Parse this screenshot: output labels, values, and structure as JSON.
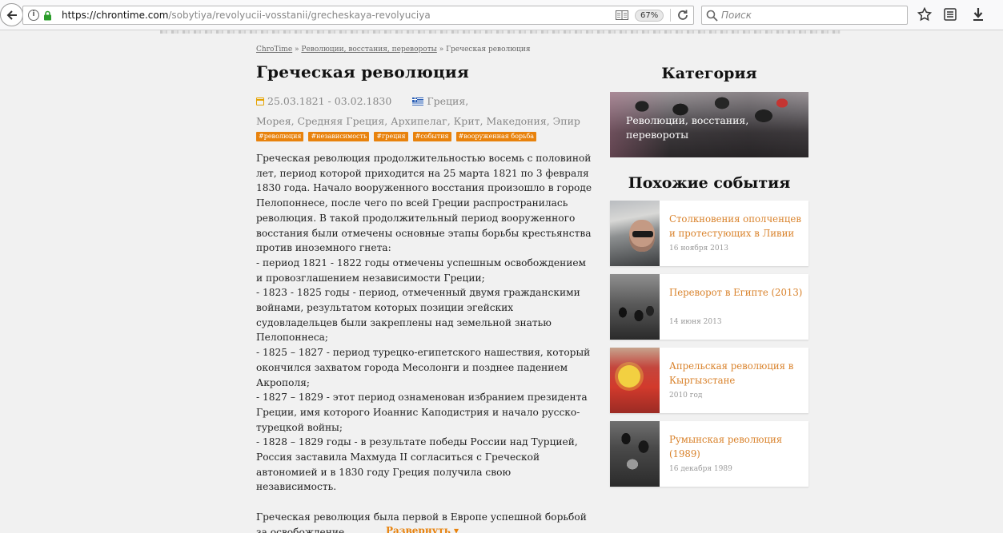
{
  "browser": {
    "url_host": "https://chrontime.com",
    "url_path": "/sobytiya/revolyucii-vosstanii/grecheskaya-revolyuciya",
    "zoom": "67%",
    "search_placeholder": "Поиск",
    "icons": [
      "back-arrow-icon",
      "info-icon",
      "lock-icon",
      "reader-view-icon",
      "reload-icon",
      "search-icon",
      "star-icon",
      "library-icon",
      "download-icon"
    ]
  },
  "breadcrumb": {
    "home": "ChroTime",
    "sep1": " » ",
    "category": "Революции, восстания, перевороты",
    "sep2": " » ",
    "current": "Греческая революция"
  },
  "article": {
    "title": "Греческая революция",
    "dates": "25.03.1821 - 03.02.1830",
    "location_line1": "Греция,",
    "location_line2": "Морея, Средняя Греция, Архипелаг, Крит, Македония, Эпир",
    "tags": [
      "#революция",
      "#независимость",
      "#греция",
      "#события",
      "#вооруженная борьба"
    ],
    "body": "Греческая революция продолжительностью восемь с половиной лет, период которой приходится на 25 марта 1821 по 3 февраля 1830 года. Начало вооруженного восстания произошло в городе Пелопоннесе, после чего по всей Греции распространилась революция. В такой продолжительный период вооруженного восстания были отмечены основные этапы борьбы крестьянства против иноземного гнета:\n- период 1821 - 1822 годы отмечены успешным освобождением и провозглашением независимости Греции;\n- 1823 - 1825 годы - период, отмеченный двумя гражданскими войнами, результатом которых позиции эгейских судовладельцев были закреплены над земельной знатью Пелопоннеса;\n- 1825 – 1827 - период турецко-египетского нашествия, который окончился захватом города Месолонги и позднее падением Акрополя;\n- 1827 – 1829 - этот период ознаменован избранием президента Греции, имя которого Иоаннис Каподистрия и начало русско-турецкой войны;\n- 1828 – 1829 годы - в результате победы России над Турцией, Россия заставила Махмуда II согласиться с Греческой автономией и в 1830 году Греция получила свою независимость.\n\nГреческая революция была первой в Европе успешной борьбой за освобождение.",
    "expand_label": "Развернуть ▾"
  },
  "sidebar": {
    "category_heading": "Категория",
    "category_label": "Революции, восстания, перевороты",
    "related_heading": "Похожие события",
    "related": [
      {
        "title": "Столкновения ополченцев и протестующих в Ливии",
        "date": "16 ноября 2013"
      },
      {
        "title": "Переворот в Египте (2013)",
        "date": "14 июня 2013"
      },
      {
        "title": "Апрельская революция в Кыргызстане",
        "date": "2010 год"
      },
      {
        "title": "Румынская революция (1989)",
        "date": "16 декабря 1989"
      }
    ]
  },
  "colors": {
    "accent": "#e8820c",
    "link": "#d9822b",
    "page_bg": "#f1f1f1"
  }
}
